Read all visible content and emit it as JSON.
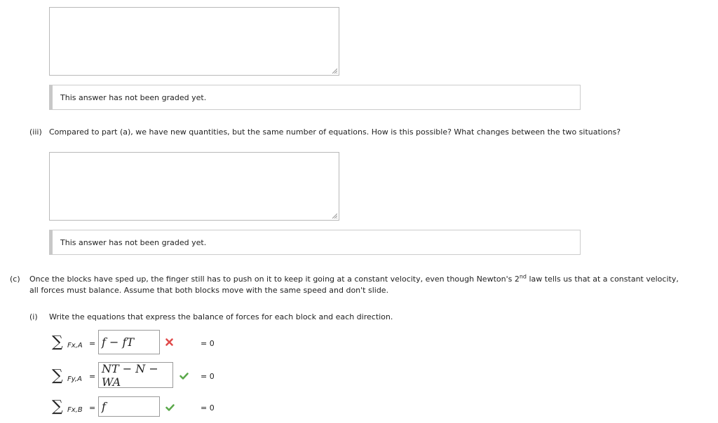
{
  "graded_message": "This answer has not been graded yet.",
  "part_b_iii": {
    "label": "(iii)",
    "text": "Compared to part (a), we have new quantities, but the same number of equations. How is this possible? What changes between the two situations?"
  },
  "part_c": {
    "label": "(c)",
    "line1_before": "Once the blocks have sped up, the finger still has to push on it to keep it going at a constant velocity, even though Newton's 2",
    "line1_sup": "nd",
    "line1_after": " law tells us that at a constant velocity,",
    "line2": "all forces must balance. Assume that both blocks move with the same speed and don't slide."
  },
  "part_c_i": {
    "label": "(i)",
    "text": "Write the equations that express the balance of forces for each block and each direction."
  },
  "equations": [
    {
      "sum": "∑",
      "subscript": "Fx,A",
      "eq": "=",
      "answer": "f − fT",
      "status": "incorrect",
      "equals_zero": "= 0"
    },
    {
      "sum": "∑",
      "subscript": "Fy,A",
      "eq": "=",
      "answer": "NT − N − WA",
      "status": "correct",
      "equals_zero": "= 0"
    },
    {
      "sum": "∑",
      "subscript": "Fx,B",
      "eq": "=",
      "answer": "f",
      "status": "correct",
      "equals_zero": "= 0"
    }
  ],
  "colors": {
    "incorrect": "#e04a4a",
    "correct": "#5aa84a"
  }
}
